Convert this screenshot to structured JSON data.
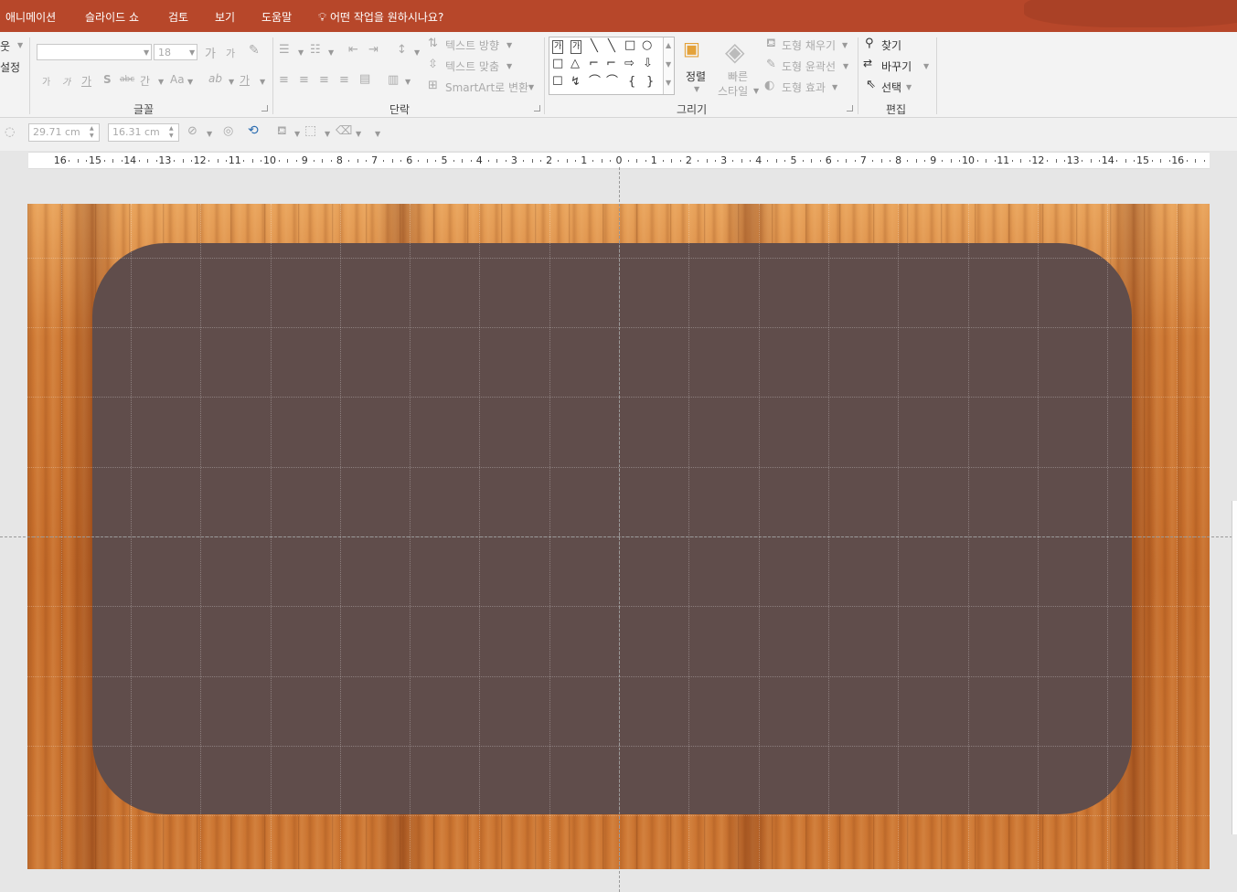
{
  "tabs": {
    "animation": "애니메이션",
    "slideshow": "슬라이드 쇼",
    "review": "검토",
    "view": "보기",
    "help": "도움말",
    "tell_me": "어떤 작업을 원하시나요?"
  },
  "ribbon": {
    "left_cut": {
      "layout_partial": "웃",
      "reset_partial": "설정"
    },
    "font": {
      "group_label": "글꼴",
      "font_name": "",
      "font_size": "18",
      "buttons": {
        "grow": "가",
        "shrink": "가",
        "bold": "가",
        "italic": "가",
        "underline": "가",
        "shadow": "S",
        "strike": "abc",
        "spacing": "간",
        "case": "Aa",
        "highlight": "ab",
        "color": "가"
      }
    },
    "paragraph": {
      "group_label": "단락",
      "text_direction": "텍스트 방향",
      "align_text": "텍스트 맞춤",
      "smartart": "SmartArt로 변환"
    },
    "drawing": {
      "group_label": "그리기",
      "arrange": "정렬",
      "quick_styles_1": "빠른",
      "quick_styles_2": "스타일",
      "shape_fill": "도형 채우기",
      "shape_outline": "도형 윤곽선",
      "shape_effects": "도형 효과",
      "shapes": [
        "가",
        "가",
        "╲",
        "╲",
        "□",
        "○",
        "□",
        "△",
        "⌐",
        "⌐",
        "⇨",
        "⇩",
        "☐",
        "↯",
        "⌒",
        "⌒",
        "{",
        "}"
      ]
    },
    "editing": {
      "group_label": "편집",
      "find": "찾기",
      "replace": "바꾸기",
      "select": "선택"
    }
  },
  "format_bar": {
    "width_value": "29.71 cm",
    "height_value": "16.31 cm"
  },
  "ruler": {
    "labels": [
      "16",
      "15",
      "14",
      "13",
      "12",
      "11",
      "10",
      "9",
      "8",
      "7",
      "6",
      "5",
      "4",
      "3",
      "2",
      "1",
      "0",
      "1",
      "2",
      "3",
      "4",
      "5",
      "6",
      "7",
      "8",
      "9",
      "10",
      "11",
      "12",
      "13",
      "14",
      "15",
      "16"
    ]
  },
  "slide": {
    "background": "wood",
    "panel_color": "#604d4b"
  },
  "colors": {
    "accent": "#b7472a",
    "ribbon_bg": "#f3f3f3",
    "workspace_bg": "#e6e6e6"
  }
}
